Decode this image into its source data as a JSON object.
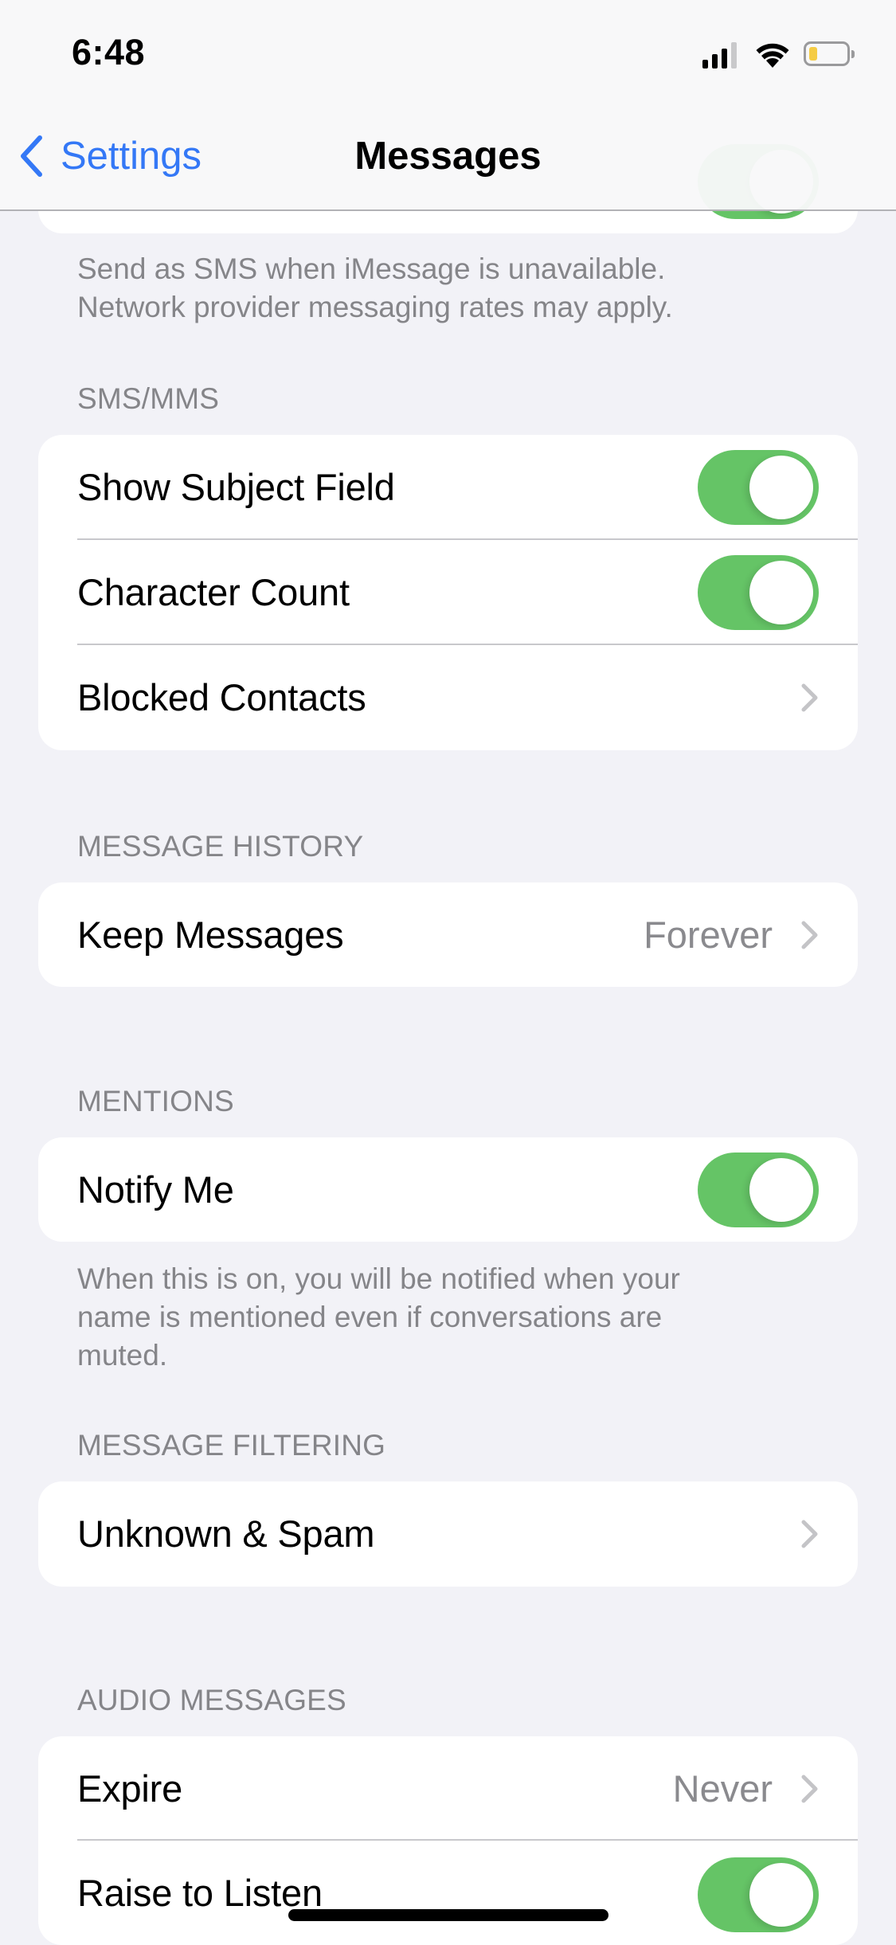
{
  "status_bar": {
    "time": "6:48",
    "signal_bars_active": 3,
    "signal_bars_total": 4,
    "wifi": "full",
    "battery_level_fraction": 0.2,
    "battery_low_power_mode": true,
    "colors": {
      "battery_fill": "#f5cc45"
    }
  },
  "nav": {
    "back_label": "Settings",
    "title": "Messages",
    "colors": {
      "tint": "#3478f6"
    }
  },
  "sections": {
    "imessage_partial": {
      "footer_lines": [
        "Send as SMS when iMessage is unavailable.",
        "Network provider messaging rates may apply."
      ],
      "partial_toggle_on": true
    },
    "sms_mms": {
      "header": "SMS/MMS",
      "rows": [
        {
          "label": "Show Subject Field",
          "type": "toggle",
          "on": true
        },
        {
          "label": "Character Count",
          "type": "toggle",
          "on": true
        },
        {
          "label": "Blocked Contacts",
          "type": "disclosure"
        }
      ]
    },
    "message_history": {
      "header": "MESSAGE HISTORY",
      "rows": [
        {
          "label": "Keep Messages",
          "type": "disclosure",
          "value": "Forever"
        }
      ]
    },
    "mentions": {
      "header": "MENTIONS",
      "rows": [
        {
          "label": "Notify Me",
          "type": "toggle",
          "on": true
        }
      ],
      "footer_lines": [
        "When this is on, you will be notified when your",
        "name is mentioned even if conversations are",
        "muted."
      ]
    },
    "message_filtering": {
      "header": "MESSAGE FILTERING",
      "rows": [
        {
          "label": "Unknown & Spam",
          "type": "disclosure"
        }
      ]
    },
    "audio_messages": {
      "header": "AUDIO MESSAGES",
      "rows": [
        {
          "label": "Expire",
          "type": "disclosure",
          "value": "Never"
        },
        {
          "label": "Raise to Listen",
          "type": "toggle",
          "on": true
        }
      ]
    }
  },
  "colors": {
    "background": "#f2f2f7",
    "toggle_on": "#65c466",
    "secondary_text": "#858589",
    "chevron": "#c4c4c7"
  }
}
